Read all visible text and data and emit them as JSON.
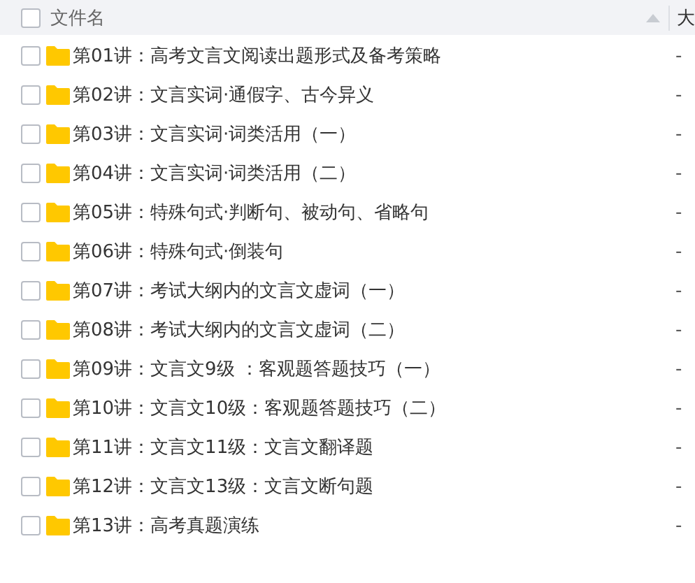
{
  "header": {
    "checked": false,
    "name_column": "文件名",
    "sort_ascending": true,
    "size_column": "大"
  },
  "rows": [
    {
      "name": "第01讲：高考文言文阅读出题形式及备考策略",
      "size": "-",
      "checked": false
    },
    {
      "name": "第02讲：文言实词·通假字、古今异义",
      "size": "-",
      "checked": false
    },
    {
      "name": "第03讲：文言实词·词类活用（一）",
      "size": "-",
      "checked": false
    },
    {
      "name": "第04讲：文言实词·词类活用（二）",
      "size": "-",
      "checked": false
    },
    {
      "name": "第05讲：特殊句式·判断句、被动句、省略句",
      "size": "-",
      "checked": false
    },
    {
      "name": "第06讲：特殊句式·倒装句",
      "size": "-",
      "checked": false
    },
    {
      "name": "第07讲：考试大纲内的文言文虚词（一）",
      "size": "-",
      "checked": false
    },
    {
      "name": "第08讲：考试大纲内的文言文虚词（二）",
      "size": "-",
      "checked": false
    },
    {
      "name": "第09讲：文言文9级 ：客观题答题技巧（一）",
      "size": "-",
      "checked": false
    },
    {
      "name": "第10讲：文言文10级：客观题答题技巧（二）",
      "size": "-",
      "checked": false
    },
    {
      "name": "第11讲：文言文11级：文言文翻译题",
      "size": "-",
      "checked": false
    },
    {
      "name": "第12讲：文言文13级：文言文断句题",
      "size": "-",
      "checked": false
    },
    {
      "name": "第13讲：高考真题演练",
      "size": "-",
      "checked": false
    }
  ]
}
